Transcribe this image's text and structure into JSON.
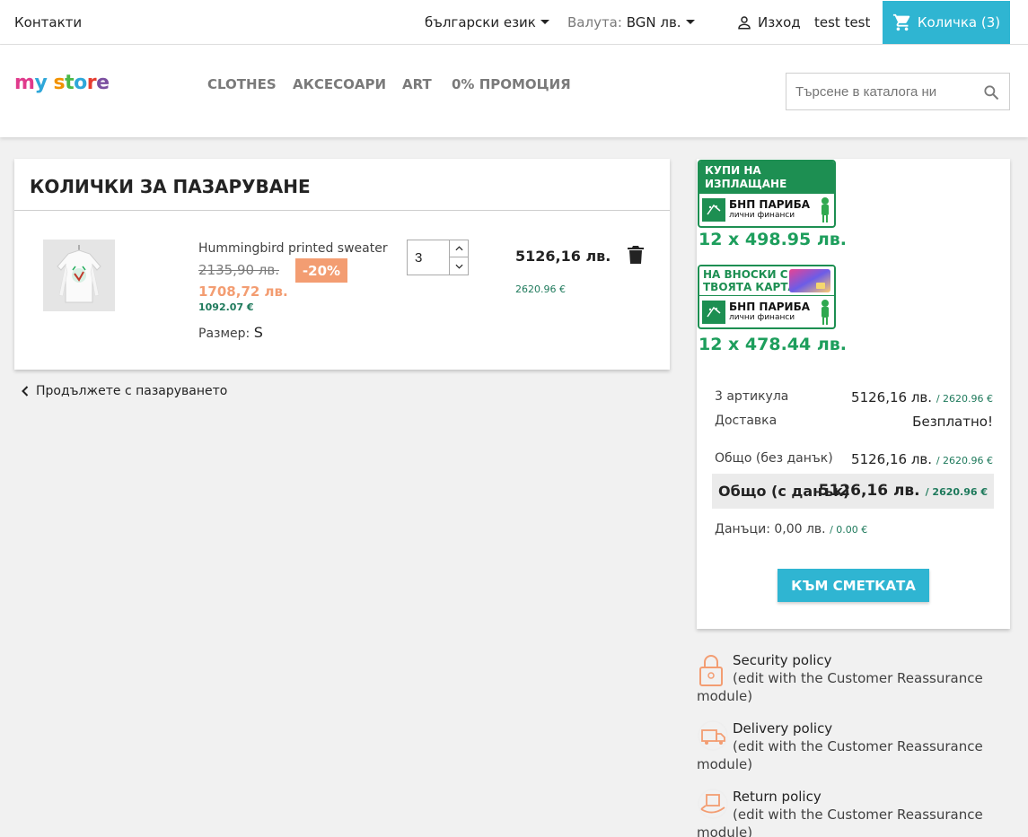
{
  "topbar": {
    "contacts": "Контакти",
    "language": "български език",
    "currency_label": "Валута:",
    "currency_value": "BGN лв.",
    "logout": "Изход",
    "username": "test test",
    "cart": "Количка (3)"
  },
  "header": {
    "logo": "my store",
    "nav": [
      "CLOTHES",
      "АКСЕСОАРИ",
      "ART",
      "0% ПРОМОЦИЯ"
    ],
    "search_placeholder": "Търсене в каталога ни"
  },
  "cart": {
    "title": "КОЛИЧКИ ЗА ПАЗАРУВАНЕ",
    "item": {
      "name": "Hummingbird printed sweater",
      "old_price": "2135,90 лв.",
      "discount": "-20%",
      "price": "1708,72 лв.",
      "price_eur": "1092.07 €",
      "size_label": "Размер:",
      "size_value": "S",
      "quantity": "3",
      "total": "5126,16 лв.",
      "total_eur": "2620.96 €"
    },
    "continue": "Продължете с пазаруването"
  },
  "summary": {
    "bnp1": {
      "head": "КУПИ НА ИЗПЛАЩАНЕ",
      "bank": "БНП ПАРИБА",
      "sub": "лични финанси",
      "installment": "12 x 498.95 лв."
    },
    "bnp2": {
      "head_line1": "НА ВНОСКИ С",
      "head_line2": "ТВОЯТА КАРТА",
      "bank": "БНП ПАРИБА",
      "sub": "лични финанси",
      "installment": "12 x 478.44 лв."
    },
    "items_label": "3 артикула",
    "items_value": "5126,16 лв.",
    "items_eur": "/ 2620.96 €",
    "shipping_label": "Доставка",
    "shipping_value": "Безплатно!",
    "subtotal_label": "Общо (без данък)",
    "subtotal_value": "5126,16 лв.",
    "subtotal_eur": "/ 2620.96 €",
    "total_label": "Общо (с данък)",
    "total_value": "5126,16 лв.",
    "total_eur": "/ 2620.96 €",
    "tax_label": "Данъци:",
    "tax_value": "0,00 лв.",
    "tax_eur": "/ 0.00 €",
    "checkout": "КЪМ СМЕТКАТА"
  },
  "reassurance": [
    {
      "title": "Security policy",
      "desc": "(edit with the Customer Reassurance module)",
      "icon": "lock-icon"
    },
    {
      "title": "Delivery policy",
      "desc": "(edit with the Customer Reassurance module)",
      "icon": "truck-icon"
    },
    {
      "title": "Return policy",
      "desc": "(edit with the Customer Reassurance module)",
      "icon": "return-box-icon"
    }
  ],
  "colors": {
    "accent": "#2fb5d2",
    "discount": "#f39d72",
    "bnp_green": "#1d8f52"
  }
}
